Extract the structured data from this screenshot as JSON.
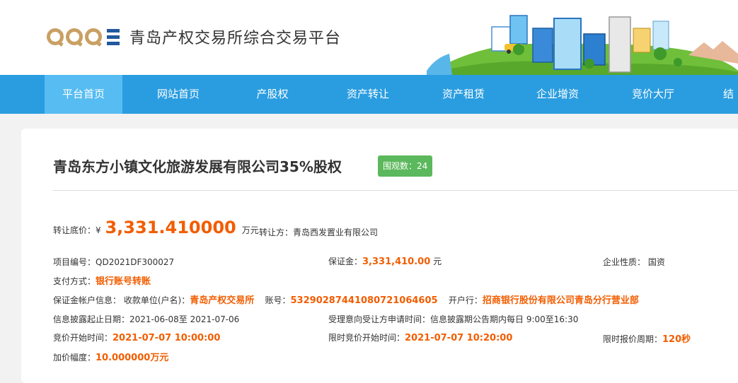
{
  "header": {
    "platform_name": "青岛产权交易所综合交易平台"
  },
  "nav": {
    "items": [
      {
        "label": "平台首页"
      },
      {
        "label": "网站首页"
      },
      {
        "label": "产股权"
      },
      {
        "label": "资产转让"
      },
      {
        "label": "资产租赁"
      },
      {
        "label": "企业增资"
      },
      {
        "label": "竞价大厅"
      },
      {
        "label": "结"
      }
    ],
    "active_index": 0
  },
  "listing": {
    "title": "青岛东方小镇文化旅游发展有限公司35%股权",
    "views_badge": "围观数：24",
    "base_price_label": "转让底价：",
    "currency_symbol": "¥",
    "base_price": "3,331.410000",
    "price_unit": "万元",
    "seller_label": "转让方：",
    "seller": "青岛西发置业有限公司",
    "project_no_label": "项目编号：",
    "project_no": "QD2021DF300027",
    "deposit_label": "保证金：",
    "deposit": "3,331,410.00",
    "deposit_unit": "元",
    "nature_label": "企业性质：",
    "nature": "国资",
    "payment_label": "支付方式：",
    "payment": "银行账号转账",
    "account_info_label": "保证金帐户信息：",
    "payee_label": "收款单位(户名)：",
    "payee": "青岛产权交易所",
    "account_no_label": "账号：",
    "account_no": "532902874410807210646­05",
    "bank_label": "开户行：",
    "bank": "招商银行股份有限公司青岛分行营业部",
    "disclosure_label": "信息披露起止日期：",
    "disclosure_period": "2021-06-08至 2021-07-06",
    "apply_time_label": "受理意向受让方申请时间：",
    "apply_time": "信息披露期公告期内每日 9:00至16:30",
    "bid_start_label": "竞价开始时间：",
    "bid_start": "2021-07-07 10:00:00",
    "timed_bid_start_label": "限时竞价开始时间：",
    "timed_bid_start": "2021-07-07 10:20:00",
    "timed_cycle_label": "限时报价周期：",
    "timed_cycle": "120秒",
    "increment_label": "加价幅度：",
    "increment": "10.000000万元"
  }
}
